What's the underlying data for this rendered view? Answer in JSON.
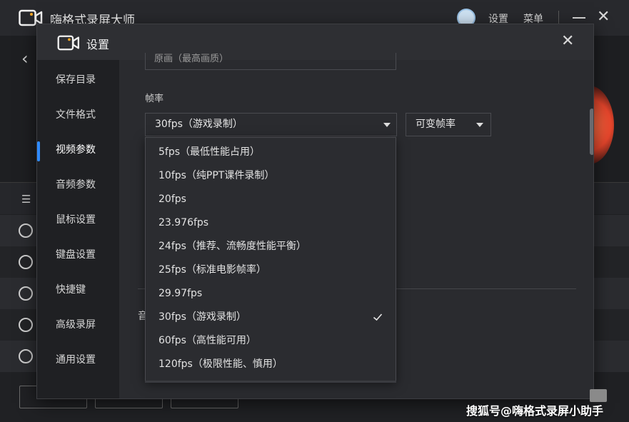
{
  "app": {
    "title": "嗨格式录屏大师",
    "settings_label": "设置",
    "menu_label": "菜单"
  },
  "dialog": {
    "title": "设置",
    "sidebar": [
      {
        "label": "保存目录"
      },
      {
        "label": "文件格式"
      },
      {
        "label": "视频参数",
        "active": true
      },
      {
        "label": "音频参数"
      },
      {
        "label": "鼠标设置"
      },
      {
        "label": "键盘设置"
      },
      {
        "label": "快捷键"
      },
      {
        "label": "高级录屏"
      },
      {
        "label": "通用设置"
      }
    ],
    "resolution_partial": "原画（最高画质）",
    "fps_label": "帧率",
    "fps_selected": "30fps（游戏录制）",
    "fps_mode_selected": "可变帧率",
    "audio_label_partial": "音",
    "fps_options": [
      {
        "label": "5fps（最低性能占用）",
        "selected": false
      },
      {
        "label": "10fps（纯PPT课件录制）",
        "selected": false
      },
      {
        "label": "20fps",
        "selected": false
      },
      {
        "label": "23.976fps",
        "selected": false
      },
      {
        "label": "24fps（推荐、流畅度性能平衡）",
        "selected": false
      },
      {
        "label": "25fps（标准电影帧率）",
        "selected": false
      },
      {
        "label": "29.97fps",
        "selected": false
      },
      {
        "label": "30fps（游戏录制）",
        "selected": true
      },
      {
        "label": "60fps（高性能可用）",
        "selected": false
      },
      {
        "label": "120fps（极限性能、慎用）",
        "selected": false
      }
    ]
  },
  "watermark": "搜狐号@嗨格式录屏小助手",
  "colors": {
    "accent": "#2f8bff",
    "record_button": "#e8462c",
    "logo_dot": "#f5a623"
  }
}
